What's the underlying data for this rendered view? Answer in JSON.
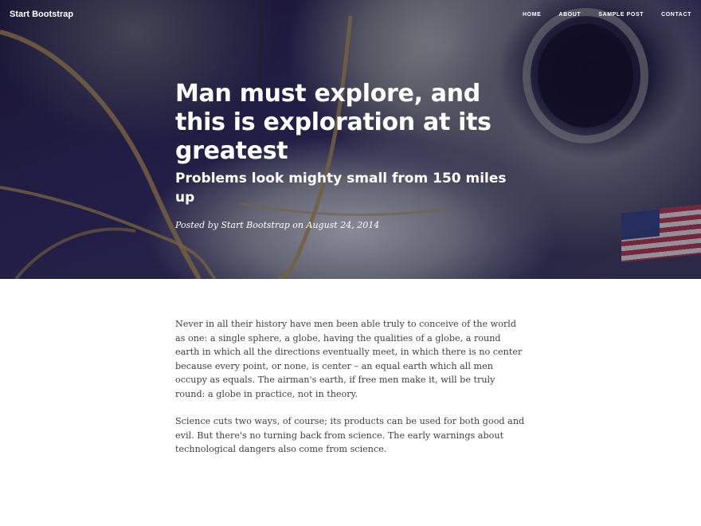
{
  "navbar": {
    "brand": "Start Bootstrap",
    "links": [
      "HOME",
      "ABOUT",
      "SAMPLE POST",
      "CONTACT"
    ]
  },
  "header": {
    "title": "Man must explore, and this is exploration at its greatest",
    "subtitle": "Problems look mighty small from 150 miles up",
    "meta": "Posted by Start Bootstrap on August 24, 2014"
  },
  "content": {
    "paragraphs": [
      "Never in all their history have men been able truly to conceive of the world as one: a single sphere, a globe, having the qualities of a globe, a round earth in which all the directions eventually meet, in which there is no center because every point, or none, is center – an equal earth which all men occupy as equals. The airman's earth, if free men make it, will be truly round: a globe in practice, not in theory.",
      "Science cuts two ways, of course; its products can be used for both good and evil. But there's no turning back from science. The early warnings about technological dangers also come from science."
    ]
  },
  "colors": {
    "body_text": "#404040",
    "hero_overlay": "#141032",
    "nav_text": "#ffffff"
  }
}
